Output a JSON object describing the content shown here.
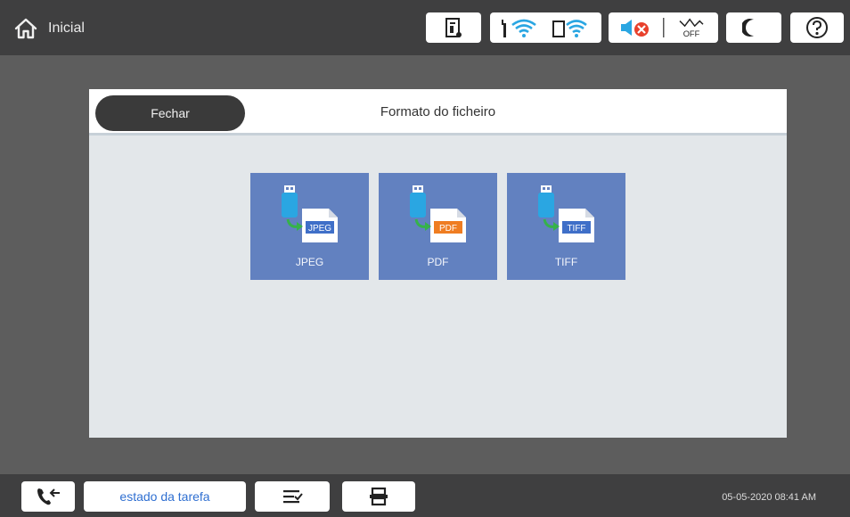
{
  "topbar": {
    "home_label": "Inicial",
    "icons": [
      "printer-status-icon",
      "wifi-icon",
      "wifi-direct-icon",
      "sound-off-icon",
      "eco-off-icon",
      "sleep-icon",
      "help-icon"
    ],
    "eco_off_label": "OFF"
  },
  "dialog": {
    "close_label": "Fechar",
    "title": "Formato do ficheiro",
    "formats": [
      {
        "label": "JPEG",
        "badge": "JPEG",
        "badge_color": "#3f6fc8"
      },
      {
        "label": "PDF",
        "badge": "PDF",
        "badge_color": "#ef7d22"
      },
      {
        "label": "TIFF",
        "badge": "TIFF",
        "badge_color": "#3f6fc8"
      }
    ]
  },
  "bottombar": {
    "task_status_label": "estado da tarefa",
    "datetime": "05-05-2020 08:41 AM"
  },
  "colors": {
    "background": "#5d5d5d",
    "bar": "#3f3f40",
    "tile": "#6281c0",
    "link": "#2f6fd1"
  }
}
